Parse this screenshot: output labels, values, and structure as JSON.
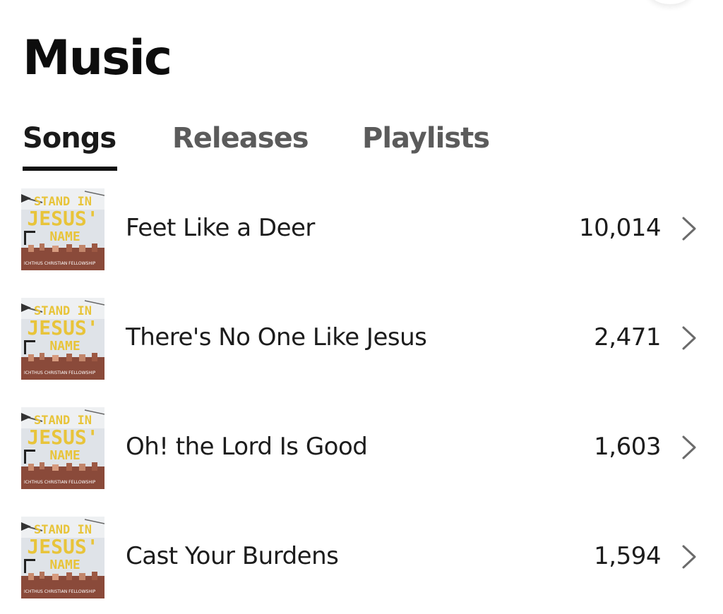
{
  "page": {
    "title": "Music"
  },
  "tabs": [
    {
      "label": "Songs",
      "active": true
    },
    {
      "label": "Releases",
      "active": false
    },
    {
      "label": "Playlists",
      "active": false
    }
  ],
  "cover_art": {
    "line1": "STAND IN",
    "line2": "JESUS'",
    "line3": "NAME",
    "artist": "ICHTHUS CHRISTIAN FELLOWSHIP",
    "accent_color": "#e8c43a"
  },
  "songs": [
    {
      "title": "Feet Like a Deer",
      "plays": "10,014"
    },
    {
      "title": "There's No One Like Jesus",
      "plays": "2,471"
    },
    {
      "title": "Oh! the Lord Is Good",
      "plays": "1,603"
    },
    {
      "title": "Cast Your Burdens",
      "plays": "1,594"
    }
  ],
  "icons": {
    "row_action": "chevron-right-icon"
  }
}
